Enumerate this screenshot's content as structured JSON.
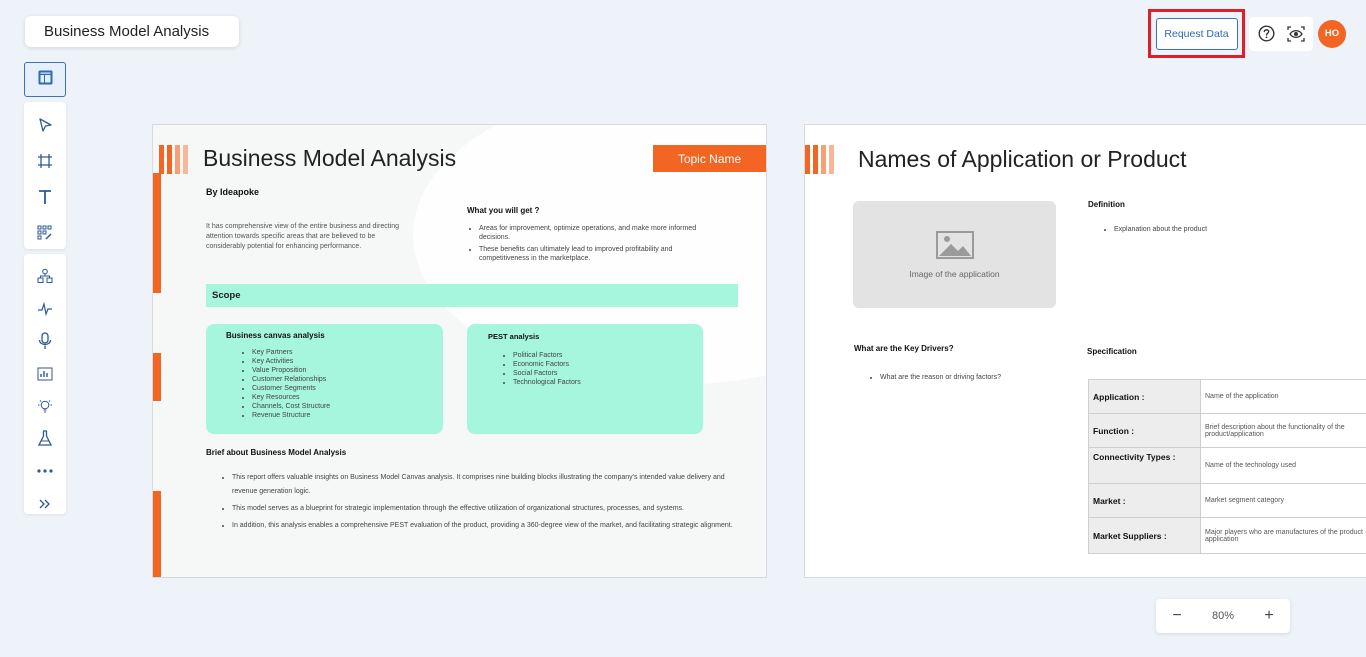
{
  "app": {
    "title": "Business Model Analysis"
  },
  "header": {
    "request_label": "Request Data",
    "avatar_initials": "HO",
    "highlight_color": "#e11d2a"
  },
  "toolbar": {
    "layout_icon": "layout-icon",
    "tools_group1": [
      "pointer-icon",
      "frame-icon",
      "text-icon",
      "components-icon"
    ],
    "tools_group2": [
      "hierarchy-icon",
      "pulse-icon",
      "mic-icon",
      "chart-icon",
      "bulb-icon",
      "flask-icon",
      "more-icon",
      "expand-icon"
    ]
  },
  "slide1": {
    "title": "Business Model Analysis",
    "topic": "Topic Name",
    "by": "By Ideapoke",
    "intro": "It has comprehensive view of the entire business and directing attention towards specific areas that are believed to be considerably potential for enhancing performance.",
    "what_heading": "What you will get ?",
    "what_items": [
      "Areas for improvement, optimize operations, and make more informed decisions.",
      "These benefits can ultimately lead to improved profitability and competitiveness in the marketplace."
    ],
    "scope_label": "Scope",
    "canvas_heading": "Business canvas analysis",
    "canvas_items": [
      "Key Partners",
      "Key Activities",
      "Value Proposition",
      "Customer Relationships",
      "Customer Segments",
      "Key Resources",
      "Channels, Cost Structure",
      "Revenue Structure"
    ],
    "pest_heading": "PEST analysis",
    "pest_items": [
      "Political Factors",
      "Economic Factors",
      "Social Factors",
      "Technological Factors"
    ],
    "brief_heading": "Brief about Business Model Analysis",
    "brief_items": [
      "This report offers valuable insights on Business Model Canvas analysis. It comprises nine building blocks illustrating the company's intended value delivery and revenue generation logic.",
      "This model serves as a blueprint for strategic implementation through the effective utilization of organizational structures, processes, and systems.",
      "In addition, this analysis enables a comprehensive PEST evaluation of the product, providing a 360-degree view of the market, and facilitating strategic alignment."
    ]
  },
  "slide2": {
    "title": "Names of Application or Product",
    "image_label": "Image of the application",
    "definition_heading": "Definition",
    "definition_item": "Explanation about the product",
    "drivers_heading": "What are the Key Drivers?",
    "drivers_item": "What are the reason or driving factors?",
    "spec_heading": "Specification",
    "spec_rows": [
      {
        "key": "Application :",
        "value": "Name of the application"
      },
      {
        "key": "Function :",
        "value": "Brief description about the functionality of the product/application"
      },
      {
        "key": "Connectivity Types :",
        "value": "Name of the technology used"
      },
      {
        "key": "Market :",
        "value": "Market segment category"
      },
      {
        "key": "Market Suppliers :",
        "value": "Major players who are manufactures of the product application"
      }
    ]
  },
  "zoom": {
    "minus": "−",
    "level": "80%",
    "plus": "+"
  }
}
